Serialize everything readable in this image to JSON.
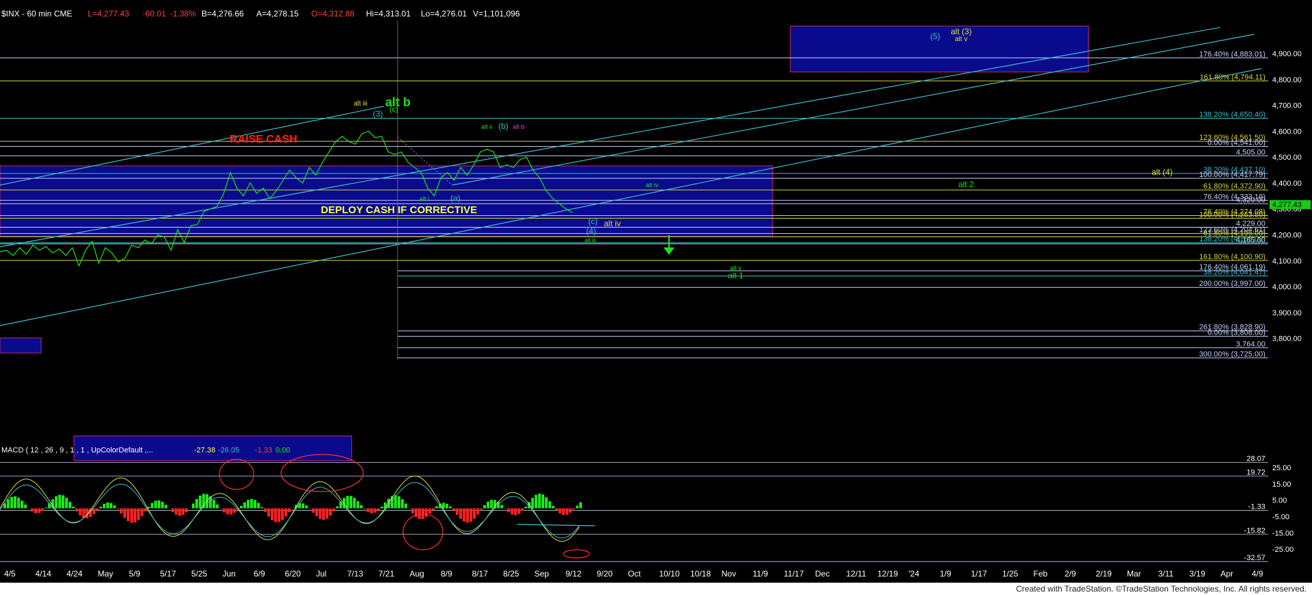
{
  "header": {
    "symbol": "$INX - 60 min  CME",
    "last": "L=4,277.43",
    "change": "-60.01",
    "pct": "-1.38%",
    "bid": "B=4,276.66",
    "ask": "A=4,278.15",
    "open": "O=4,312.88",
    "high": "Hi=4,313.01",
    "low": "Lo=4,276.01",
    "volume": "V=1,101,096"
  },
  "macd_header": {
    "label": "MACD ( 12 , 26 , 9 , 1 , 1 , UpColorDefault ,...",
    "v1": "-27.38",
    "v2": "-26.05",
    "v3": "-1.33",
    "v4": "0.00"
  },
  "footer": {
    "credit": "Created with TradeStation. ©TradeStation Technologies, Inc. All rights reserved."
  },
  "colors": {
    "price": "#19e619",
    "fib_white": "#c8d0ff",
    "fib_yellow": "#d8d840",
    "fib_cyan": "#3fbfd0",
    "box": "#0a0a8c",
    "box_border": "#c03060"
  },
  "chart_data": {
    "type": "line",
    "price_axis": {
      "ylim": [
        3725,
        4990
      ],
      "ticks": [
        "4,900.00",
        "4,800.00",
        "4,700.00",
        "4,600.00",
        "4,500.00",
        "4,400.00",
        "4,300.00",
        "4,200.00",
        "4,100.00",
        "4,000.00",
        "3,900.00",
        "3,800.00"
      ],
      "tick_values": [
        4900,
        4800,
        4700,
        4600,
        4500,
        4400,
        4300,
        4200,
        4100,
        4000,
        3900,
        3800
      ]
    },
    "macd_axis": {
      "ticks": [
        "25.00",
        "15.00",
        "5.00",
        "-5.00",
        "-15.00",
        "-25.00"
      ],
      "tick_values": [
        25,
        15,
        5,
        -5,
        -15,
        -25
      ],
      "ylim": [
        -35,
        30
      ]
    },
    "x_ticks": [
      "4/5",
      "4/14",
      "4/24",
      "May",
      "5/9",
      "5/17",
      "5/25",
      "Jun",
      "6/9",
      "6/20",
      "Jul",
      "7/13",
      "7/21",
      "Aug",
      "8/9",
      "8/17",
      "8/25",
      "Sep",
      "9/12",
      "9/20",
      "Oct",
      "10/10",
      "10/18",
      "Nov",
      "11/9",
      "11/17",
      "Dec",
      "12/11",
      "12/19",
      "'24",
      "1/9",
      "1/17",
      "1/25",
      "Feb",
      "2/9",
      "2/19",
      "Mar",
      "3/11",
      "3/19",
      "Apr",
      "4/9"
    ],
    "price_path": {
      "x": [
        0,
        8,
        16,
        24,
        32,
        40,
        48,
        56,
        64,
        72,
        80,
        88,
        96,
        104,
        112,
        120,
        128,
        136,
        144,
        152,
        160,
        168,
        176,
        184,
        192,
        200,
        208,
        216,
        224,
        232,
        240,
        248,
        256,
        264,
        272,
        280,
        288,
        296,
        304,
        312,
        320,
        328,
        336,
        344,
        352,
        360,
        368,
        376,
        384,
        392,
        400,
        408,
        416,
        424,
        432,
        440,
        448,
        456,
        464,
        472,
        480,
        488,
        496,
        504,
        512,
        520,
        528,
        536,
        544,
        552,
        560,
        568,
        576,
        584,
        592,
        600,
        608,
        616,
        624,
        632,
        640,
        648,
        656,
        664,
        672,
        680,
        688,
        696
      ],
      "y": [
        4135,
        4140,
        4120,
        4150,
        4125,
        4160,
        4140,
        4155,
        4130,
        4145,
        4120,
        4150,
        4080,
        4140,
        4175,
        4090,
        4150,
        4130,
        4095,
        4110,
        4160,
        4150,
        4180,
        4165,
        4200,
        4190,
        4140,
        4220,
        4170,
        4235,
        4240,
        4290,
        4300,
        4310,
        4360,
        4440,
        4380,
        4350,
        4400,
        4360,
        4380,
        4340,
        4370,
        4410,
        4450,
        4420,
        4400,
        4460,
        4430,
        4480,
        4520,
        4560,
        4580,
        4560,
        4550,
        4590,
        4600,
        4575,
        4580,
        4520,
        4510,
        4520,
        4480,
        4460,
        4440,
        4380,
        4350,
        4420,
        4440,
        4410,
        4460,
        4430,
        4470,
        4520,
        4530,
        4520,
        4460,
        4470,
        4460,
        4490,
        4500,
        4450,
        4420,
        4370,
        4340,
        4320,
        4300,
        4285
      ]
    },
    "fib_levels": [
      {
        "label": "176.40% (4,883.01)",
        "value": 4883,
        "color": "white"
      },
      {
        "label": "161.80% (4,794.11)",
        "value": 4794,
        "color": "yellow"
      },
      {
        "label": "138.20% (4,650.40)",
        "value": 4650,
        "color": "cyan"
      },
      {
        "label": "123.60% (4,561.50)",
        "value": 4561,
        "color": "yellow"
      },
      {
        "label": "0.00% (4,541.00)",
        "value": 4541,
        "color": "white"
      },
      {
        "label": "4,505.00",
        "value": 4505,
        "color": "white"
      },
      {
        "label": "38.20% (4,437.10)",
        "value": 4437,
        "color": "cyan"
      },
      {
        "label": "100.00% (4,417.79)",
        "value": 4418,
        "color": "white"
      },
      {
        "label": "61.80% (4,372.90)",
        "value": 4373,
        "color": "yellow"
      },
      {
        "label": "76.40% (4,333.19)",
        "value": 4333,
        "color": "white"
      },
      {
        "label": "4,320.00",
        "value": 4320,
        "color": "white"
      },
      {
        "label": "76.40% (4,274.08)",
        "value": 4274,
        "color": "yellow"
      },
      {
        "label": "100.00% (4,263.80)",
        "value": 4264,
        "color": "yellow"
      },
      {
        "label": "4,229.00",
        "value": 4229,
        "color": "white"
      },
      {
        "label": "123.60% (4,204.61)",
        "value": 4205,
        "color": "white"
      },
      {
        "label": "61.80% (4,195.00)",
        "value": 4192,
        "color": "yellow"
      },
      {
        "label": "138.20% (4,165.00)",
        "value": 4170,
        "color": "cyan"
      },
      {
        "label": "4,165.00",
        "value": 4165,
        "color": "white"
      },
      {
        "label": "161.80% (4,100.90)",
        "value": 4101,
        "color": "yellow"
      },
      {
        "label": "176.40% (4,061.19)",
        "value": 4061,
        "color": "white"
      },
      {
        "label": "38.20% (4,041.47)",
        "value": 4041,
        "color": "cyan"
      },
      {
        "label": "200.00% (3,997.00)",
        "value": 3997,
        "color": "white"
      },
      {
        "label": "261.80% (3,828.90)",
        "value": 3829,
        "color": "white"
      },
      {
        "label": "0.00% (3,808.00)",
        "value": 3808,
        "color": "white"
      },
      {
        "label": "3,764.00",
        "value": 3764,
        "color": "white"
      },
      {
        "label": "300.00% (3,725.00)",
        "value": 3725,
        "color": "white"
      }
    ],
    "last_price_tag": "4,277.43",
    "macd_right_labels": [
      {
        "label": "19.72",
        "value": 19.72
      },
      {
        "label": "-1.33",
        "value": -1.33
      },
      {
        "label": "-15.82",
        "value": -15.82
      },
      {
        "label": "-32.57",
        "value": -32.57
      },
      {
        "label": "28.07",
        "value": 28.07
      }
    ],
    "annotations": {
      "raise_cash": "RAISE CASH",
      "deploy_cash": "DEPLOY CASH IF CORRECTIVE",
      "alt_b": "alt b",
      "alt_iii_top": "alt iii",
      "w3": "(3)",
      "wc_top": "(c)",
      "alt_ii": "alt ii",
      "wb": "(b)",
      "alt_b_small": "alt b",
      "alt_i": "alt i",
      "wa": "(a)",
      "wc": "(c)",
      "w4": "(4)",
      "alt_iv": "alt iv",
      "alt_iii": "alt iii",
      "alt_iv_2": "alt iv",
      "alt_2": "alt 2",
      "alt_4": "alt (4)",
      "alt_v": "alt v",
      "alt_1": "alt 1",
      "w5": "(5)",
      "alt_3": "alt (3)",
      "alt_v_top": "alt v"
    }
  }
}
